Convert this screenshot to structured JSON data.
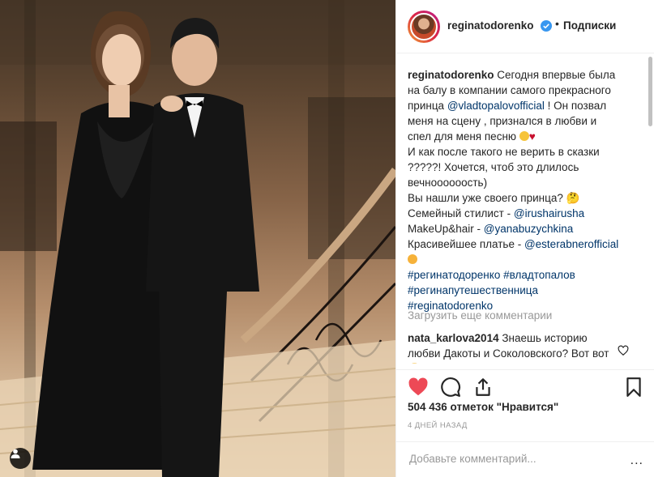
{
  "header": {
    "username": "reginatodorenko",
    "separator": "•",
    "follow_label": "Подписки"
  },
  "caption": {
    "username": "reginatodorenko",
    "lines": [
      "Сегодня впервые была",
      "на балу в компании самого прекрасного",
      "принца",
      "@vladtopalovofficial",
      "! Он позвал",
      "меня на сцену , признался в любви и",
      "спел для меня песню",
      "И как после такого не верить в сказки",
      "?????! Хочется, чтоб это длилось",
      "вечноооооость)",
      "Вы нашли уже своего принца? 🤔",
      "Семейный стилист - ",
      "@irushairusha",
      "MakeUp&hair - ",
      "@yanabuzychkina",
      "Красивейшее платье - ",
      "@esterabnerofficial",
      "#регинатодоренко",
      "#владтопалов",
      "#регинапутешественница",
      "#reginatodorenko"
    ]
  },
  "load_more": "Загрузить еще комментарии",
  "comment": {
    "username": "nata_karlova2014",
    "text": "Знаешь историю любви Дакоты и Соколовского? Вот вот😏)))"
  },
  "icons": {
    "like": "heart-filled-icon",
    "comment": "comment-bubble-icon",
    "share": "share-icon",
    "save": "bookmark-icon",
    "tagged": "user-tag-icon",
    "verified": "verified-badge-icon"
  },
  "likes": "504 436 отметок \"Нравится\"",
  "time_ago": "4 ДНЕЙ НАЗАД",
  "add_comment": {
    "placeholder": "Добавьте комментарий...",
    "more_label": "..."
  },
  "colors": {
    "like_red": "#ed4956",
    "link_blue": "#003569",
    "verified_blue": "#3897f0",
    "muted_gray": "#999999"
  }
}
